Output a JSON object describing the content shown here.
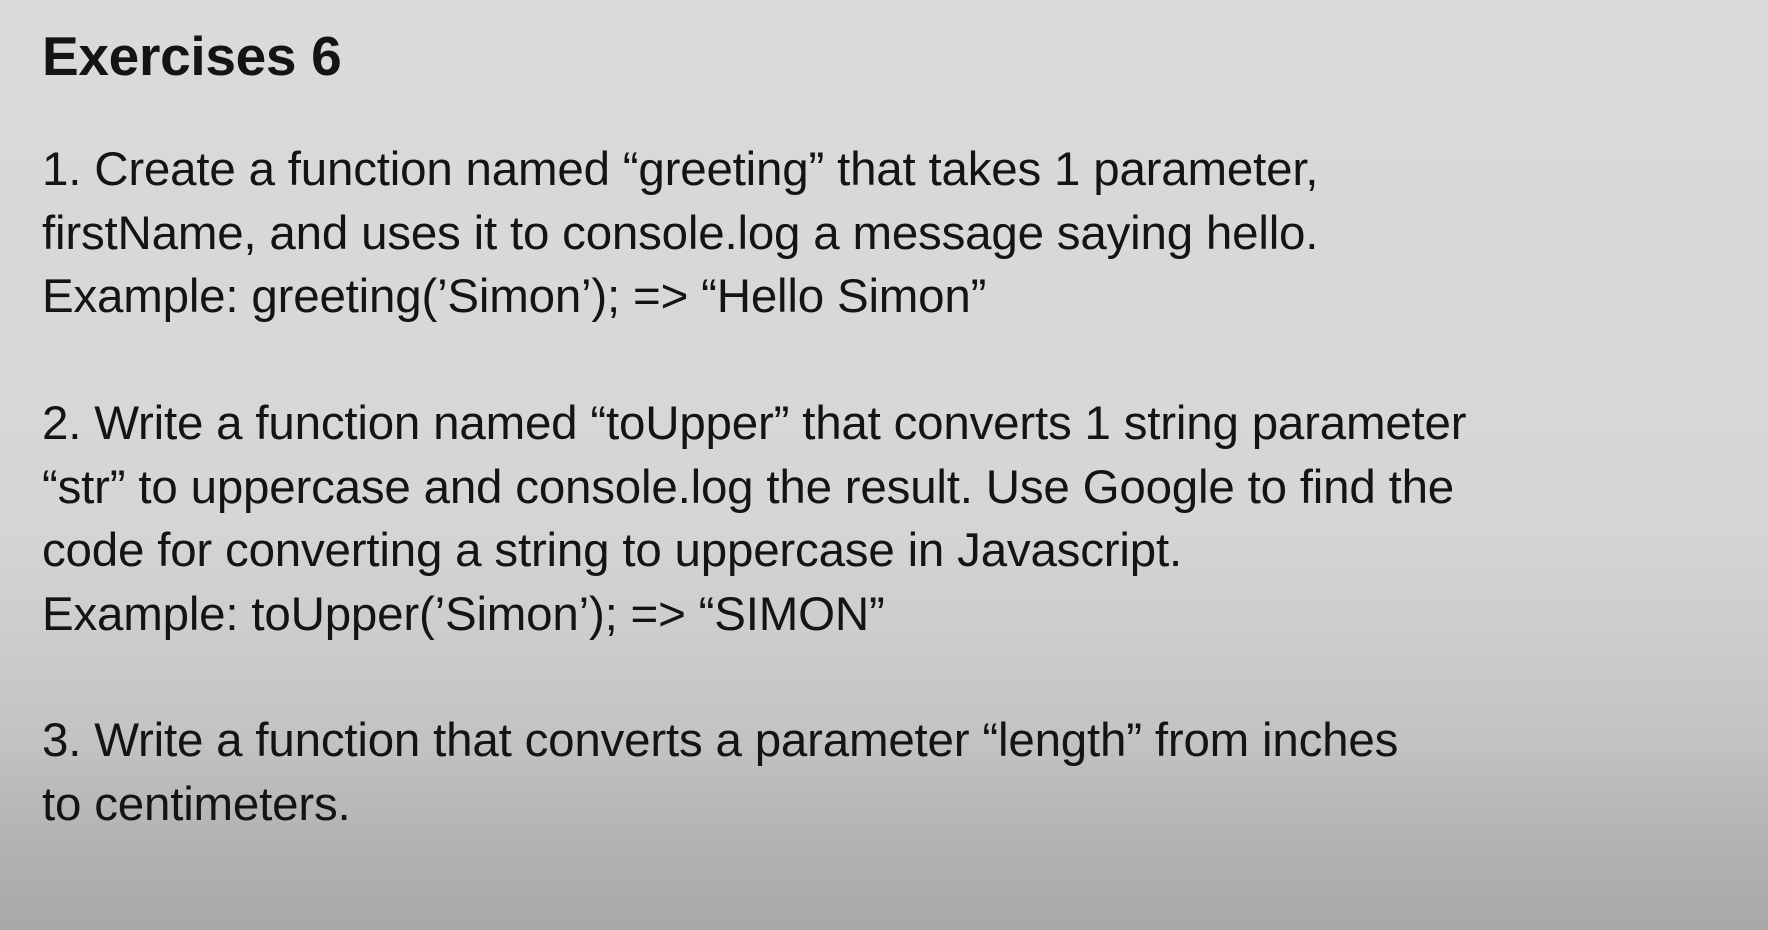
{
  "slide": {
    "title": "Exercises 6",
    "exercises": [
      {
        "lines": [
          "1. Create a function named “greeting” that takes 1 parameter,",
          "firstName, and uses it to console.log a message saying hello.",
          "Example: greeting(’Simon’); => “Hello Simon”"
        ]
      },
      {
        "lines": [
          "2. Write a function named “toUpper” that converts 1 string parameter",
          "“str” to uppercase and console.log the result. Use Google to find the",
          "code for converting a string to uppercase in Javascript.",
          "Example: toUpper(’Simon’); => “SIMON”"
        ]
      },
      {
        "lines": [
          "3. Write a function that converts a parameter “length” from inches",
          "to centimeters."
        ]
      }
    ]
  }
}
